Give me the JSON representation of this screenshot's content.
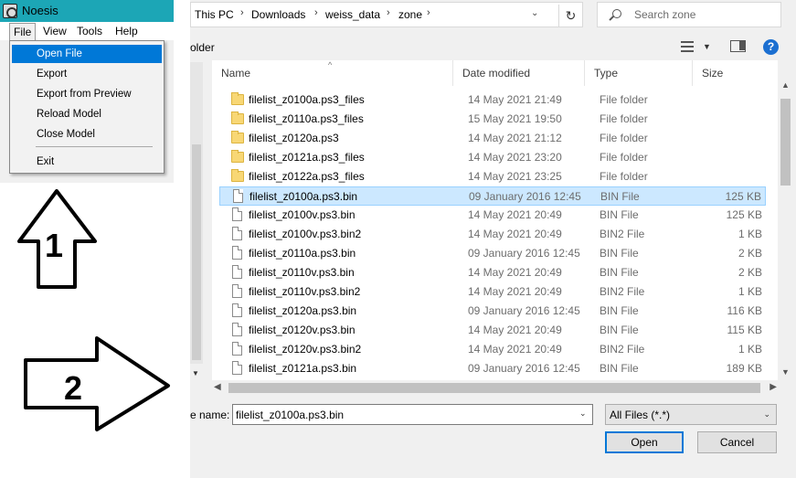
{
  "noesis": {
    "title": "Noesis",
    "menus": [
      "File",
      "View",
      "Tools",
      "Help"
    ],
    "file_menu": {
      "items": [
        "Open File",
        "Export",
        "Export from Preview",
        "Reload Model",
        "Close Model",
        "Exit"
      ],
      "highlighted": "Open File"
    }
  },
  "annotations": {
    "arrow_1_label": "1",
    "arrow_2_label": "2"
  },
  "dialog": {
    "breadcrumb": [
      "This PC",
      "Downloads",
      "weiss_data",
      "zone"
    ],
    "search_placeholder": "Search zone",
    "toolbar_text": "older",
    "columns": [
      "Name",
      "Date modified",
      "Type",
      "Size"
    ],
    "rows": [
      {
        "name": "filelist_z0100a.ps3_files",
        "date": "14 May 2021 21:49",
        "type": "File folder",
        "size": "",
        "icon": "folder-icon"
      },
      {
        "name": "filelist_z0110a.ps3_files",
        "date": "15 May 2021 19:50",
        "type": "File folder",
        "size": "",
        "icon": "folder-icon"
      },
      {
        "name": "filelist_z0120a.ps3",
        "date": "14 May 2021 21:12",
        "type": "File folder",
        "size": "",
        "icon": "folder-icon"
      },
      {
        "name": "filelist_z0121a.ps3_files",
        "date": "14 May 2021 23:20",
        "type": "File folder",
        "size": "",
        "icon": "folder-icon"
      },
      {
        "name": "filelist_z0122a.ps3_files",
        "date": "14 May 2021 23:25",
        "type": "File folder",
        "size": "",
        "icon": "folder-icon"
      },
      {
        "name": "filelist_z0100a.ps3.bin",
        "date": "09 January 2016 12:45",
        "type": "BIN File",
        "size": "125 KB",
        "icon": "file-icon",
        "selected": true
      },
      {
        "name": "filelist_z0100v.ps3.bin",
        "date": "14 May 2021 20:49",
        "type": "BIN File",
        "size": "125 KB",
        "icon": "file-icon"
      },
      {
        "name": "filelist_z0100v.ps3.bin2",
        "date": "14 May 2021 20:49",
        "type": "BIN2 File",
        "size": "1 KB",
        "icon": "file-icon"
      },
      {
        "name": "filelist_z0110a.ps3.bin",
        "date": "09 January 2016 12:45",
        "type": "BIN File",
        "size": "2 KB",
        "icon": "file-icon"
      },
      {
        "name": "filelist_z0110v.ps3.bin",
        "date": "14 May 2021 20:49",
        "type": "BIN File",
        "size": "2 KB",
        "icon": "file-icon"
      },
      {
        "name": "filelist_z0110v.ps3.bin2",
        "date": "14 May 2021 20:49",
        "type": "BIN2 File",
        "size": "1 KB",
        "icon": "file-icon"
      },
      {
        "name": "filelist_z0120a.ps3.bin",
        "date": "09 January 2016 12:45",
        "type": "BIN File",
        "size": "116 KB",
        "icon": "file-icon"
      },
      {
        "name": "filelist_z0120v.ps3.bin",
        "date": "14 May 2021 20:49",
        "type": "BIN File",
        "size": "115 KB",
        "icon": "file-icon"
      },
      {
        "name": "filelist_z0120v.ps3.bin2",
        "date": "14 May 2021 20:49",
        "type": "BIN2 File",
        "size": "1 KB",
        "icon": "file-icon"
      },
      {
        "name": "filelist_z0121a.ps3.bin",
        "date": "09 January 2016 12:45",
        "type": "BIN File",
        "size": "189 KB",
        "icon": "file-icon"
      }
    ],
    "filename_label": "e name:",
    "filename_value": "filelist_z0100a.ps3.bin",
    "filter_value": "All Files (*.*)",
    "open_label": "Open",
    "cancel_label": "Cancel"
  },
  "colors": {
    "noesis_titlebar": "#1ca6b6",
    "menu_highlight": "#0078d7",
    "selected_row": "#cce8ff",
    "folder": "#f8d775"
  }
}
